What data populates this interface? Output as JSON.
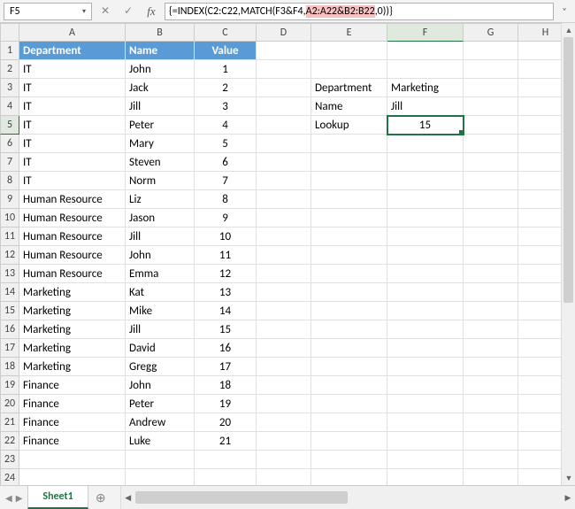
{
  "namebox": {
    "value": "F5"
  },
  "formula": {
    "pre": "{=INDEX(C2:C22,MATCH(F3&F4,",
    "highlight": "A2:A22&B2:B22",
    "post": ",0))}"
  },
  "icons": {
    "dropdown": "▾",
    "cancel": "✕",
    "accept": "✓",
    "fx": "fx",
    "expand": "˅",
    "scroll_up": "▲",
    "scroll_down": "▼",
    "scroll_left": "◀",
    "scroll_right": "▶",
    "tab_prev": "◀",
    "tab_next": "▶",
    "new_sheet": "⊕"
  },
  "columns": [
    "A",
    "B",
    "C",
    "D",
    "E",
    "F",
    "G",
    "H"
  ],
  "header_row": {
    "dept": "Department",
    "name": "Name",
    "value": "Value"
  },
  "table": [
    {
      "dept": "IT",
      "name": "John",
      "value": "1"
    },
    {
      "dept": "IT",
      "name": "Jack",
      "value": "2"
    },
    {
      "dept": "IT",
      "name": "Jill",
      "value": "3"
    },
    {
      "dept": "IT",
      "name": "Peter",
      "value": "4"
    },
    {
      "dept": "IT",
      "name": "Mary",
      "value": "5"
    },
    {
      "dept": "IT",
      "name": "Steven",
      "value": "6"
    },
    {
      "dept": "IT",
      "name": "Norm",
      "value": "7"
    },
    {
      "dept": "Human Resource",
      "name": "Liz",
      "value": "8"
    },
    {
      "dept": "Human Resource",
      "name": "Jason",
      "value": "9"
    },
    {
      "dept": "Human Resource",
      "name": "Jill",
      "value": "10"
    },
    {
      "dept": "Human Resource",
      "name": "John",
      "value": "11"
    },
    {
      "dept": "Human Resource",
      "name": "Emma",
      "value": "12"
    },
    {
      "dept": "Marketing",
      "name": "Kat",
      "value": "13"
    },
    {
      "dept": "Marketing",
      "name": "Mike",
      "value": "14"
    },
    {
      "dept": "Marketing",
      "name": "Jill",
      "value": "15"
    },
    {
      "dept": "Marketing",
      "name": "David",
      "value": "16"
    },
    {
      "dept": "Marketing",
      "name": "Gregg",
      "value": "17"
    },
    {
      "dept": "Finance",
      "name": "John",
      "value": "18"
    },
    {
      "dept": "Finance",
      "name": "Peter",
      "value": "19"
    },
    {
      "dept": "Finance",
      "name": "Andrew",
      "value": "20"
    },
    {
      "dept": "Finance",
      "name": "Luke",
      "value": "21"
    }
  ],
  "lookup": {
    "labels": {
      "dept": "Department",
      "name": "Name",
      "result": "Lookup"
    },
    "values": {
      "dept": "Marketing",
      "name": "Jill",
      "result": "15"
    }
  },
  "sheet_tab": "Sheet1",
  "row_count": 24
}
